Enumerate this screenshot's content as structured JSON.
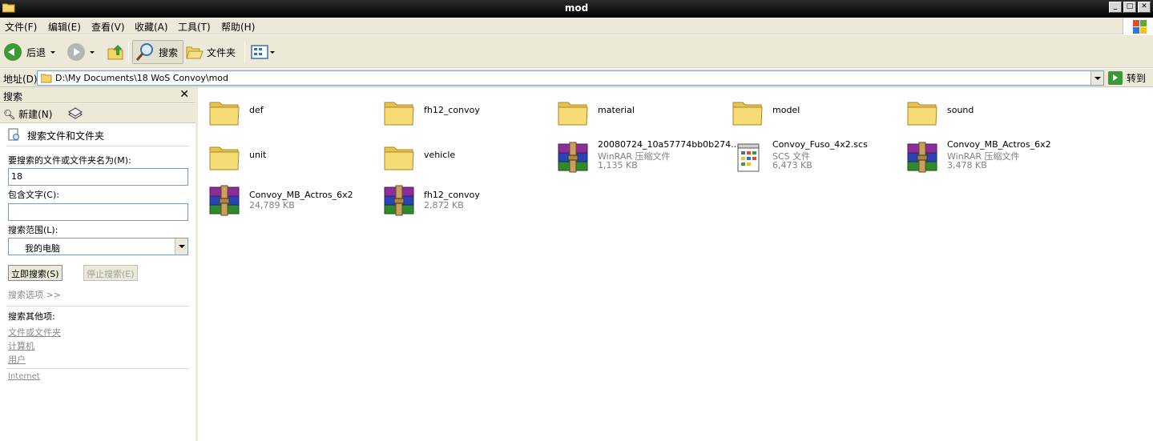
{
  "window": {
    "title": "mod",
    "min": "_",
    "max": "□",
    "close": "✕"
  },
  "menu": [
    "文件(F)",
    "编辑(E)",
    "查看(V)",
    "收藏(A)",
    "工具(T)",
    "帮助(H)"
  ],
  "toolbar": {
    "back": "后退",
    "search": "搜索",
    "folders": "文件夹"
  },
  "address": {
    "label": "地址(D)",
    "path": "D:\\My Documents\\18 WoS Convoy\\mod",
    "go": "转到"
  },
  "search_pane": {
    "header": "搜索",
    "new_label": "新建(N)",
    "title": "搜索文件和文件夹",
    "name_label": "要搜索的文件或文件夹名为(M):",
    "name_value": "18",
    "contains_label": "包含文字(C):",
    "contains_value": "",
    "scope_label": "搜索范围(L):",
    "scope_value": "我的电脑",
    "search_now": "立即搜索(S)",
    "stop": "停止搜索(E)",
    "options": "搜索选项 >>",
    "other_header": "搜索其他项:",
    "other_links": [
      "文件或文件夹",
      "计算机",
      "用户",
      "Internet"
    ]
  },
  "files": [
    {
      "name": "def",
      "type": "folder"
    },
    {
      "name": "fh12_convoy",
      "type": "folder"
    },
    {
      "name": "material",
      "type": "folder"
    },
    {
      "name": "model",
      "type": "folder"
    },
    {
      "name": "sound",
      "type": "folder"
    },
    {
      "name": "unit",
      "type": "folder"
    },
    {
      "name": "vehicle",
      "type": "folder"
    },
    {
      "name": "20080724_10a57774bb0b274...",
      "type": "rar",
      "kind": "WinRAR 压缩文件",
      "size": "1,135 KB"
    },
    {
      "name": "Convoy_Fuso_4x2.scs",
      "type": "scs",
      "kind": "SCS 文件",
      "size": "6,473 KB"
    },
    {
      "name": "Convoy_MB_Actros_6x2",
      "type": "rar",
      "kind": "WinRAR 压缩文件",
      "size": "3,478 KB"
    },
    {
      "name": "Convoy_MB_Actros_6x2",
      "type": "rar",
      "kind": "",
      "size": "24,789 KB"
    },
    {
      "name": "fh12_convoy",
      "type": "rar",
      "kind": "",
      "size": "2,872 KB"
    }
  ]
}
